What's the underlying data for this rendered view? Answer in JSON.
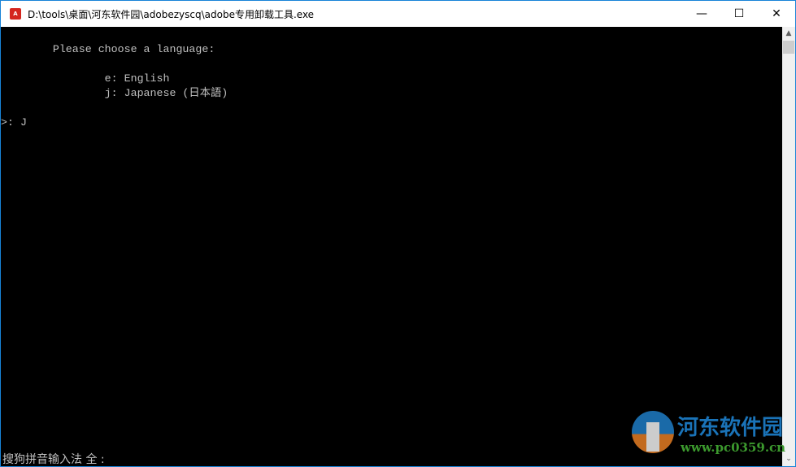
{
  "window": {
    "title": "D:\\tools\\桌面\\河东软件园\\adobezyscq\\adobe专用卸载工具.exe",
    "icon": "adobe-icon"
  },
  "controls": {
    "minimize": "—",
    "maximize": "☐",
    "close": "✕"
  },
  "console": {
    "lines": [
      "        Please choose a language:",
      "                e: English",
      "                j: Japanese (日本語)",
      ">: J"
    ]
  },
  "ime_status": "搜狗拼音输入法 全 :",
  "watermark": {
    "name": "河东软件园",
    "url": "www.pc0359.cn"
  },
  "scrollbar": {
    "up": "▲",
    "down": "⌄"
  }
}
